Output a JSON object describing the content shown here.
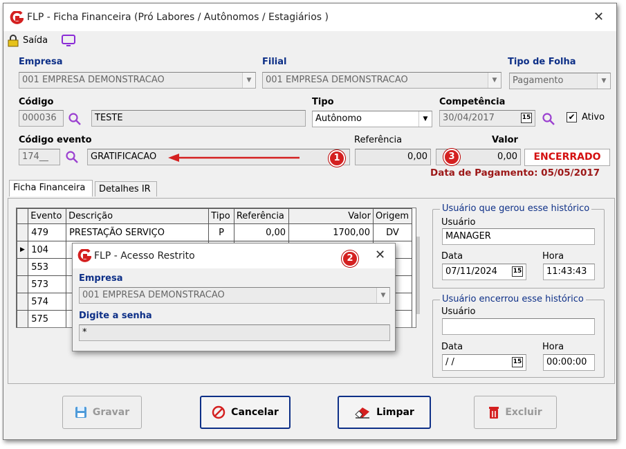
{
  "window": {
    "title": "FLP - Ficha Financeira (Pró Labores / Autônomos / Estagiários )",
    "close": "✕",
    "exit_label": "Saída"
  },
  "form": {
    "empresa_label": "Empresa",
    "empresa_value": "001 EMPRESA DEMONSTRACAO",
    "filial_label": "Filial",
    "filial_value": "001 EMPRESA DEMONSTRACAO",
    "tipo_folha_label": "Tipo de Folha",
    "tipo_folha_value": "Pagamento",
    "codigo_label": "Código",
    "codigo_value": "000036",
    "nome_value": "TESTE",
    "tipo_label": "Tipo",
    "tipo_value": "Autônomo",
    "competencia_label": "Competência",
    "competencia_value": "30/04/2017",
    "ativo_label": "Ativo",
    "codigo_evento_label": "Código evento",
    "codigo_evento_value": "174__",
    "evento_desc_value": "GRATIFICACAO",
    "referencia_label": "Referência",
    "referencia_value": "0,00",
    "valor_label": "Valor",
    "valor_value": "0,00",
    "status_value": "ENCERRADO",
    "data_pagamento": "Data de Pagamento: 05/05/2017"
  },
  "tabs": [
    "Ficha Financeira",
    "Detalhes IR"
  ],
  "grid": {
    "columns": [
      "Evento",
      "Descrição",
      "Tipo",
      "Referência",
      "Valor",
      "Origem"
    ],
    "rows": [
      [
        "479",
        "PRESTAÇÃO SERVIÇO",
        "P",
        "0,00",
        "1700,00",
        "DV"
      ],
      [
        "104",
        "",
        "",
        "",
        "",
        ""
      ],
      [
        "553",
        "",
        "",
        "",
        "",
        ""
      ],
      [
        "573",
        "",
        "",
        "",
        "",
        ""
      ],
      [
        "574",
        "",
        "",
        "",
        "",
        ""
      ],
      [
        "575",
        "",
        "",
        "",
        "",
        ""
      ]
    ]
  },
  "history_created": {
    "title": "Usuário que gerou esse histórico",
    "user_label": "Usuário",
    "user_value": "MANAGER",
    "date_label": "Data",
    "date_value": "07/11/2024",
    "time_label": "Hora",
    "time_value": "11:43:43"
  },
  "history_closed": {
    "title": "Usuário encerrou esse histórico",
    "user_label": "Usuário",
    "user_value": "",
    "date_label": "Data",
    "date_value": "/ /",
    "time_label": "Hora",
    "time_value": "00:00:00"
  },
  "buttons": {
    "save": "Gravar",
    "cancel": "Cancelar",
    "clear": "Limpar",
    "delete": "Excluir"
  },
  "dialog": {
    "title": "FLP - Acesso Restrito",
    "close": "✕",
    "empresa_label": "Empresa",
    "empresa_value": "001 EMPRESA DEMONSTRACAO",
    "senha_label": "Digite a senha",
    "senha_value": "*"
  },
  "annotations": {
    "badge1": "1",
    "badge2": "2",
    "badge3": "3",
    "accent_color": "#d42020"
  },
  "colors": {
    "label_blue": "#0d2f87",
    "status_red": "#d41010",
    "pay_date_red": "#9c1818"
  }
}
